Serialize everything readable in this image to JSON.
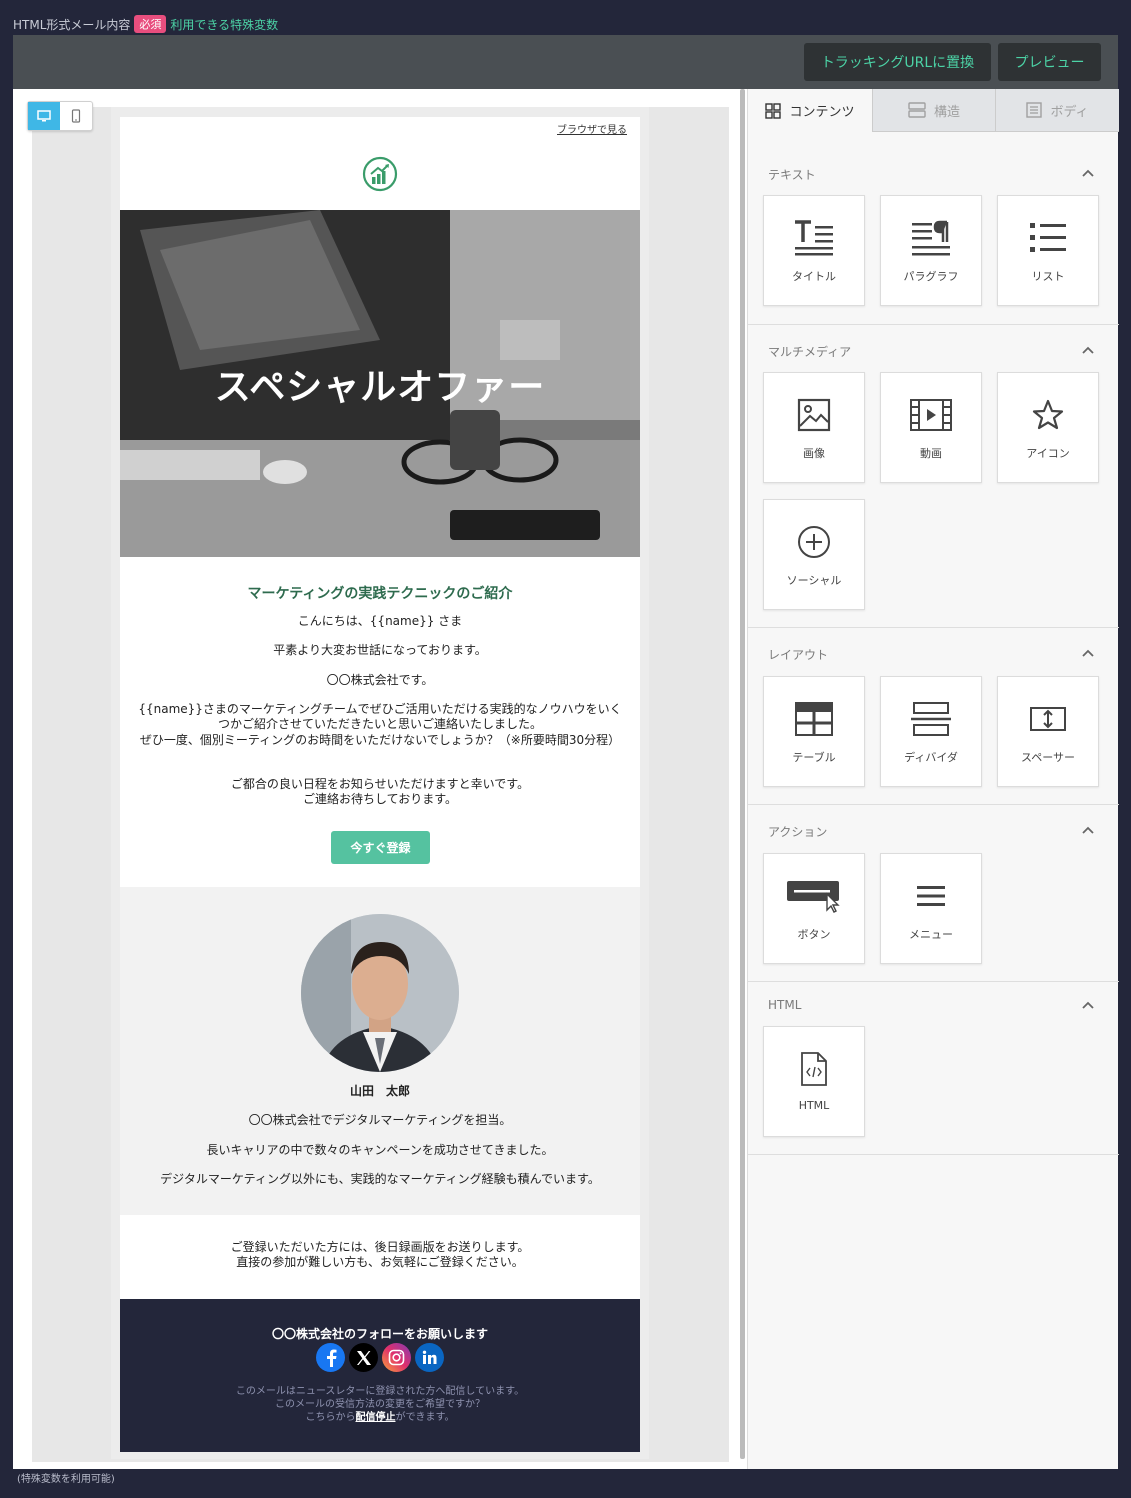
{
  "header": {
    "label": "HTML形式メール内容",
    "required_badge": "必須",
    "variables_link": "利用できる特殊変数"
  },
  "toolbar": {
    "tracking_button": "トラッキングURLに置換",
    "preview_button": "プレビュー"
  },
  "device_toggle": {
    "desktop_icon": "desktop-icon",
    "mobile_icon": "mobile-icon"
  },
  "email": {
    "view_in_browser": "ブラウザで見る",
    "hero_title": "スペシャルオファー",
    "heading": "マーケティングの実践テクニックのご紹介",
    "greeting": "こんにちは、{{name}} さま",
    "line1": "平素より大変お世話になっております。",
    "line2": "〇〇株式会社です。",
    "para1": "{{name}}さまのマーケティングチームでぜひご活用いただける実践的なノウハウをいくつかご紹介させていただきたいと思いご連絡いたしました。",
    "para2": "ぜひ一度、個別ミーティングのお時間をいただけないでしょうか？（※所要時間30分程）",
    "para3a": "ご都合の良い日程をお知らせいただけますと幸いです。",
    "para3b": "ご連絡お待ちしております。",
    "cta": "今すぐ登録",
    "profile_name": "山田　太郎",
    "profile_line1": "〇〇株式会社でデジタルマーケティングを担当。",
    "profile_line2": "長いキャリアの中で数々のキャンペーンを成功させてきました。",
    "profile_line3": "デジタルマーケティング以外にも、実践的なマーケティング経験も積んでいます。",
    "closing1": "ご登録いただいた方には、後日録画版をお送りします。",
    "closing2": "直接の参加が難しい方も、お気軽にご登録ください。",
    "follow": "〇〇株式会社のフォローをお願いします",
    "fine1": "このメールはニュースレターに登録された方へ配信しています。",
    "fine2": "このメールの受信方法の変更をご希望ですか？",
    "fine3_pre": "こちらから",
    "fine3_link": "配信停止",
    "fine3_post": "ができます。"
  },
  "footer_note": "(特殊変数を利用可能)",
  "panel": {
    "tabs": [
      {
        "label": "コンテンツ",
        "icon": "grid-icon"
      },
      {
        "label": "構造",
        "icon": "rows-icon"
      },
      {
        "label": "ボディ",
        "icon": "document-icon"
      }
    ],
    "sections": {
      "text": "テキスト",
      "media": "マルチメディア",
      "layout": "レイアウト",
      "action": "アクション",
      "html": "HTML"
    },
    "blocks": {
      "title": "タイトル",
      "paragraph": "パラグラフ",
      "list": "リスト",
      "image": "画像",
      "video": "動画",
      "icon": "アイコン",
      "social": "ソーシャル",
      "table": "テーブル",
      "divider": "ディバイダ",
      "spacer": "スペーサー",
      "button": "ボタン",
      "menu": "メニュー",
      "html": "HTML"
    }
  },
  "colors": {
    "accent": "#4cd3a6",
    "required": "#e84e7e",
    "cta": "#55c2a0",
    "dark": "#23263a",
    "heading_green": "#2e6b4e"
  }
}
